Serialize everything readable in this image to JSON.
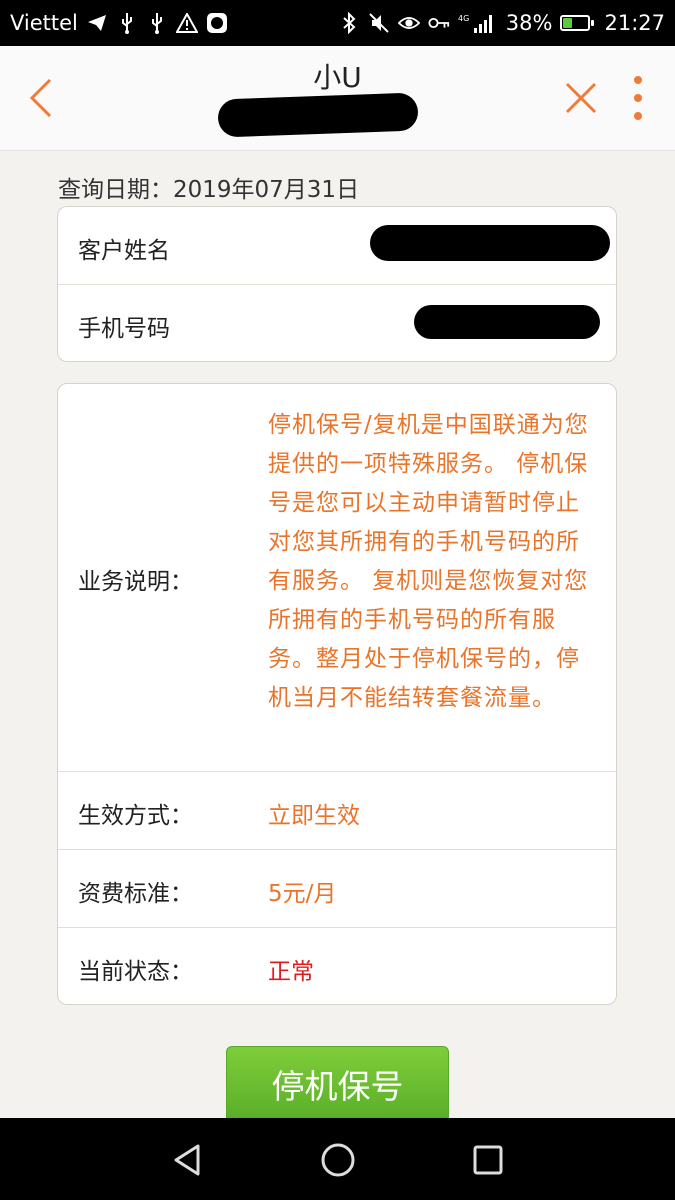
{
  "status_bar": {
    "carrier": "Viettel",
    "network": "4G",
    "battery_percent_label": "38%",
    "battery_level": 0.38,
    "time": "21:27",
    "icons": [
      "telegram-icon",
      "usb-icon",
      "usb-icon",
      "warning-icon",
      "app-badge-icon",
      "bluetooth-icon",
      "mute-icon",
      "eye-icon",
      "key-icon",
      "signal-icon",
      "battery-charging-icon"
    ]
  },
  "header": {
    "title": "小U",
    "back_icon": "chevron-left-icon",
    "close_icon": "close-icon",
    "more_icon": "more-vertical-icon",
    "accent_color": "#f07a38"
  },
  "query": {
    "label": "查询日期：",
    "date": "2019年07月31日"
  },
  "customer": {
    "name_label": "客户姓名",
    "phone_label": "手机号码"
  },
  "service": {
    "desc_label": "业务说明：",
    "desc_text": "停机保号/复机是中国联通为您提供的一项特殊服务。 停机保号是您可以主动申请暂时停止对您其所拥有的手机号码的所有服务。 复机则是您恢复对您所拥有的手机号码的所有服务。整月处于停机保号的，停机当月不能结转套餐流量。",
    "effect_label": "生效方式：",
    "effect_value": "立即生效",
    "fee_label": "资费标准：",
    "fee_value": "5元/月",
    "status_label": "当前状态：",
    "status_value": "正常"
  },
  "actions": {
    "primary_label": "停机保号"
  },
  "colors": {
    "value_orange": "#e9742a",
    "status_red": "#dd1e1e",
    "button_green": "#6cbf31"
  },
  "nav": {
    "back_icon": "nav-back-icon",
    "home_icon": "nav-home-icon",
    "recents_icon": "nav-recents-icon"
  }
}
